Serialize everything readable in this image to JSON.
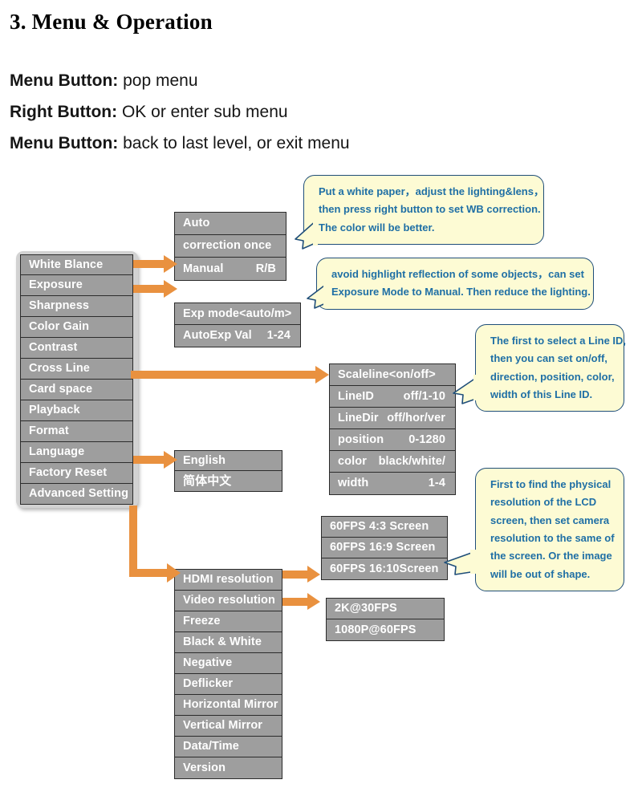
{
  "heading": "3. Menu & Operation",
  "intro": [
    {
      "label": "Menu Button:",
      "text": " pop menu"
    },
    {
      "label": "Right Button:",
      "text": " OK or enter sub menu"
    },
    {
      "label": "Menu Button:",
      "text": " back to last level, or exit menu"
    }
  ],
  "colors": {
    "menu_item_bg": "#9e9e9e",
    "menu_shell_bg": "#d2d2d2",
    "menu_border": "#2b2b2b",
    "menu_text": "#ffffff",
    "arrow": "#e9913f",
    "bubble_bg": "#fdfbd4",
    "bubble_border": "#1f4e79",
    "bubble_text": "#1f6fa5"
  },
  "main_menu": {
    "items": [
      {
        "label": "White Blance"
      },
      {
        "label": "Exposure"
      },
      {
        "label": "Sharpness"
      },
      {
        "label": "Color Gain"
      },
      {
        "label": "Contrast"
      },
      {
        "label": "Cross Line"
      },
      {
        "label": "Card space"
      },
      {
        "label": "Playback"
      },
      {
        "label": "Format"
      },
      {
        "label": "Language"
      },
      {
        "label": "Factory Reset"
      },
      {
        "label": "Advanced Setting"
      }
    ]
  },
  "white_balance_menu": {
    "items": [
      {
        "label": "Auto",
        "value": ""
      },
      {
        "label": "correction once",
        "value": ""
      },
      {
        "label": "Manual",
        "value": "R/B"
      }
    ]
  },
  "exposure_menu": {
    "items": [
      {
        "label": "Exp mode<auto/m>",
        "value": ""
      },
      {
        "label": "AutoExp Val",
        "value": "1-24"
      }
    ]
  },
  "cross_line_menu": {
    "items": [
      {
        "label": "Scaleline<on/off>",
        "value": ""
      },
      {
        "label": "LineID",
        "value": "off/1-10"
      },
      {
        "label": "LineDir",
        "value": "off/hor/ver"
      },
      {
        "label": "position",
        "value": "0-1280"
      },
      {
        "label": "color",
        "value": "black/white/"
      },
      {
        "label": "width",
        "value": "1-4"
      }
    ]
  },
  "language_menu": {
    "items": [
      {
        "label": "English"
      },
      {
        "label": "简体中文"
      }
    ]
  },
  "advanced_menu": {
    "items": [
      {
        "label": "HDMI resolution"
      },
      {
        "label": "Video resolution"
      },
      {
        "label": "Freeze"
      },
      {
        "label": "Black & White"
      },
      {
        "label": "Negative"
      },
      {
        "label": "Deflicker"
      },
      {
        "label": "Horizontal Mirror"
      },
      {
        "label": "Vertical Mirror"
      },
      {
        "label": "Data/Time"
      },
      {
        "label": "Version"
      }
    ]
  },
  "hdmi_menu": {
    "items": [
      {
        "label": "60FPS 4:3 Screen"
      },
      {
        "label": "60FPS 16:9 Screen"
      },
      {
        "label": "60FPS 16:10Screen"
      }
    ]
  },
  "video_menu": {
    "items": [
      {
        "label": "2K@30FPS"
      },
      {
        "label": "1080P@60FPS"
      }
    ]
  },
  "callouts": {
    "white_balance": {
      "lines": [
        "Put a white paper，adjust the lighting&lens，",
        "then press right button to set WB correction.",
        "The color will be better."
      ]
    },
    "exposure": {
      "lines": [
        "avoid highlight reflection of some objects，can set",
        "Exposure Mode to Manual. Then reduce the lighting."
      ]
    },
    "cross_line": {
      "lines": [
        "The first to select a Line ID,",
        "then you can set on/off,",
        "direction, position, color,",
        "width of this Line ID."
      ]
    },
    "resolution": {
      "lines": [
        "First to find the physical",
        "resolution of the LCD",
        "screen, then set camera",
        "resolution to the same of",
        "the screen. Or the image",
        "will be out of shape."
      ]
    }
  }
}
